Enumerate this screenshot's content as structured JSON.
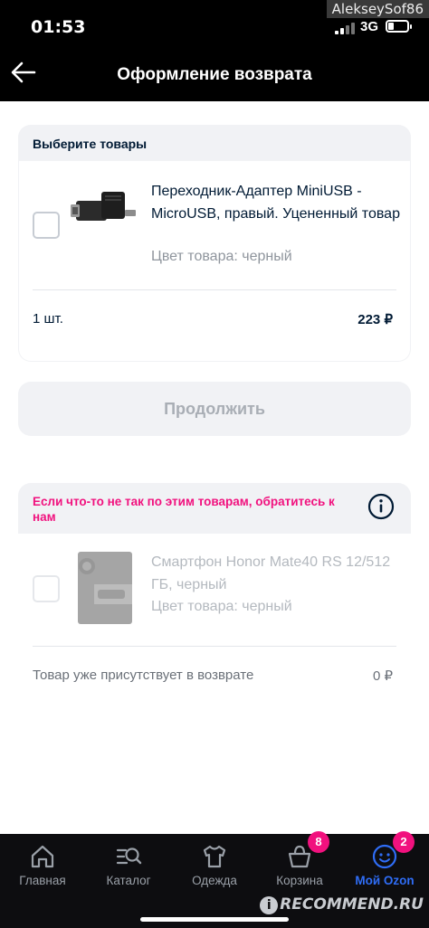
{
  "status_bar": {
    "time": "01:53",
    "network": "3G",
    "watermark": "AlekseySof86"
  },
  "header": {
    "title": "Оформление возврата"
  },
  "select_section": {
    "title": "Выберите товары",
    "item": {
      "name": "Переходник-Адаптер MiniUSB - MicroUSB, правый. Уцененный товар",
      "color": "Цвет товара: черный",
      "quantity": "1 шт.",
      "price": "223 ₽",
      "checked": false
    }
  },
  "continue_button": {
    "label": "Продолжить"
  },
  "warning_section": {
    "text": "Если что-то не так по этим товарам, обратитесь к нам",
    "item": {
      "name": "Смартфон Honor Mate40 RS 12/512 ГБ, черный",
      "color": "Цвет товара: черный",
      "status": "Товар уже присутствует в возврате",
      "price": "0 ₽"
    }
  },
  "bottom_nav": {
    "tabs": [
      {
        "label": "Главная",
        "icon": "home-icon"
      },
      {
        "label": "Каталог",
        "icon": "catalog-search-icon"
      },
      {
        "label": "Одежда",
        "icon": "shirt-icon"
      },
      {
        "label": "Корзина",
        "icon": "cart-icon",
        "badge": "8"
      },
      {
        "label": "Мой Ozon",
        "icon": "profile-smile-icon",
        "badge": "2",
        "active": true
      }
    ],
    "accent_color": "#2f6df6",
    "badge_color": "#f1117e"
  },
  "site_watermark": "RECOMMEND.RU"
}
